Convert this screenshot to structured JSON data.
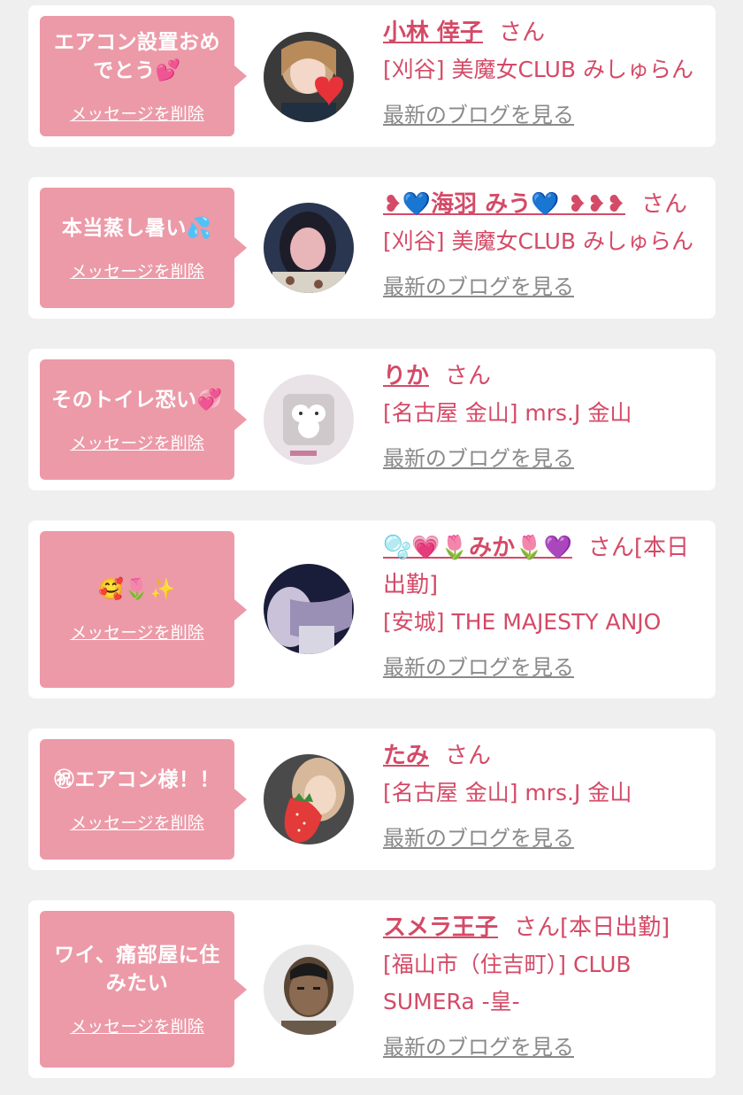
{
  "messages": [
    {
      "message": "エアコン設置おめでとう💕",
      "delete_label": "メッセージを削除",
      "name": "小林 倖子",
      "honorific": "さん",
      "shop": "[刈谷] 美魔女CLUB みしゅらん",
      "blog_label": "最新のブログを見る"
    },
    {
      "message": "本当蒸し暑い💦",
      "delete_label": "メッセージを削除",
      "name": "❥💙海羽 みう💙 ❥❥❥",
      "honorific": "さん",
      "shop": "[刈谷] 美魔女CLUB みしゅらん",
      "blog_label": "最新のブログを見る"
    },
    {
      "message": "そのトイレ恐い💞",
      "delete_label": "メッセージを削除",
      "name": "りか",
      "honorific": "さん",
      "shop": "[名古屋 金山] mrs.J 金山",
      "blog_label": "最新のブログを見る"
    },
    {
      "message": "🥰🌷✨",
      "delete_label": "メッセージを削除",
      "name": "🫧💗🌷みか🌷💜",
      "honorific": "さん[本日出勤]",
      "shop": "[安城] THE MAJESTY ANJO",
      "blog_label": "最新のブログを見る"
    },
    {
      "message": "㊗エアコン様！！",
      "delete_label": "メッセージを削除",
      "name": "たみ",
      "honorific": "さん",
      "shop": "[名古屋 金山] mrs.J 金山",
      "blog_label": "最新のブログを見る"
    },
    {
      "message": "ワイ、痛部屋に住みたい",
      "delete_label": "メッセージを削除",
      "name": "スメラ王子",
      "honorific": "さん[本日出勤]",
      "shop": "[福山市（住吉町）] CLUB SUMERa -皇-",
      "blog_label": "最新のブログを見る"
    }
  ],
  "colors": {
    "bubble": "#ec9aa8",
    "accent": "#d44a67",
    "link_gray": "#8a8a8a",
    "background": "#efefef"
  }
}
